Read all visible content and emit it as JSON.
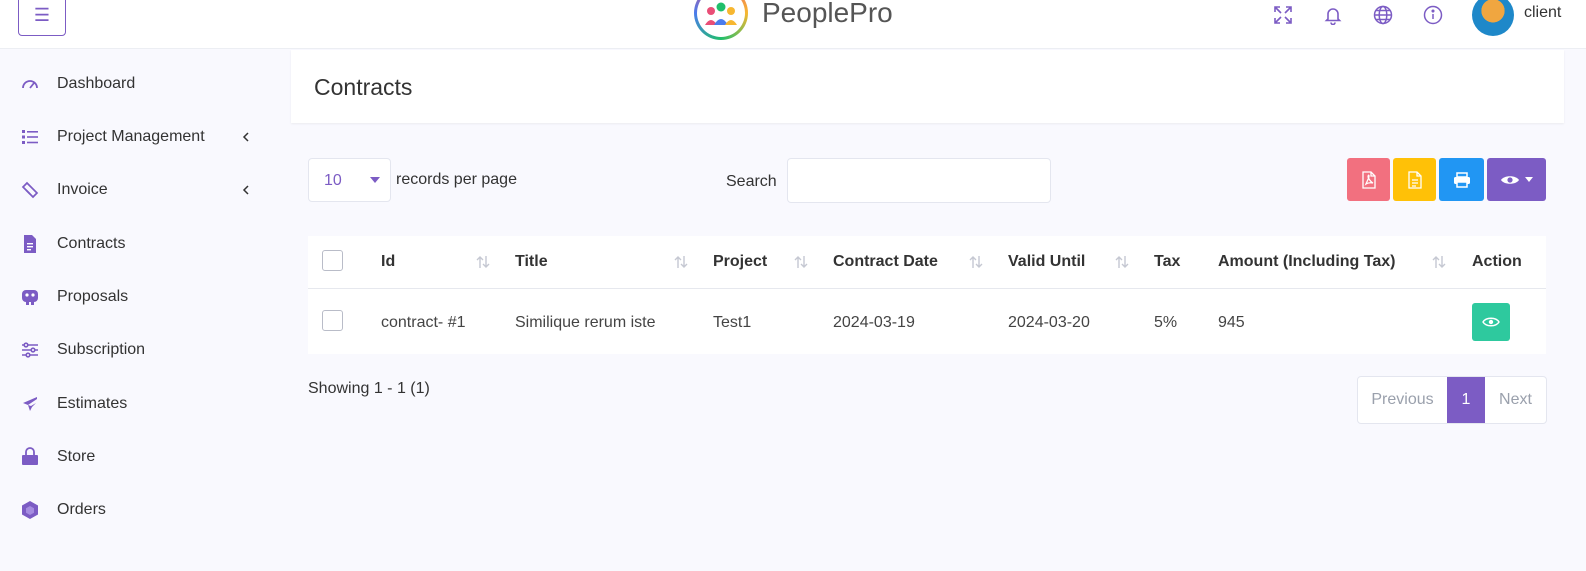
{
  "app": {
    "brand_name": "PeoplePro",
    "user_name": "client"
  },
  "topbar": {
    "icons": [
      "menu-icon",
      "fullscreen-icon",
      "bell-icon",
      "globe-icon",
      "info-icon"
    ]
  },
  "sidebar": {
    "items": [
      {
        "label": "Dashboard",
        "icon": "gauge-icon",
        "has_children": false
      },
      {
        "label": "Project Management",
        "icon": "list-icon",
        "has_children": true
      },
      {
        "label": "Invoice",
        "icon": "ticket-icon",
        "has_children": true
      },
      {
        "label": "Contracts",
        "icon": "document-icon",
        "has_children": false
      },
      {
        "label": "Proposals",
        "icon": "proposal-icon",
        "has_children": false
      },
      {
        "label": "Subscription",
        "icon": "sliders-icon",
        "has_children": false
      },
      {
        "label": "Estimates",
        "icon": "plane-icon",
        "has_children": false
      },
      {
        "label": "Store",
        "icon": "shopping-bag-icon",
        "has_children": false
      },
      {
        "label": "Orders",
        "icon": "hexagon-icon",
        "has_children": false
      }
    ]
  },
  "page": {
    "title": "Contracts"
  },
  "controls": {
    "per_page_value": "10",
    "per_page_label": "records per page",
    "search_label": "Search",
    "search_value": "",
    "buttons": [
      {
        "name": "export-pdf",
        "icon": "pdf-file-icon",
        "color": "#f2707f"
      },
      {
        "name": "export-csv",
        "icon": "file-text-icon",
        "color": "#ffc107"
      },
      {
        "name": "print",
        "icon": "printer-icon",
        "color": "#2196f3"
      },
      {
        "name": "column-visibility",
        "icon": "eye-icon",
        "color": "#7c5cc4"
      }
    ]
  },
  "table": {
    "columns": [
      "Id",
      "Title",
      "Project",
      "Contract Date",
      "Valid Until",
      "Tax",
      "Amount (Including Tax)",
      "Action"
    ],
    "rows": [
      {
        "id": "contract- #1",
        "title": "Similique rerum iste",
        "project": "Test1",
        "contract_date": "2024-03-19",
        "valid_until": "2024-03-20",
        "tax": "5%",
        "amount": "945"
      }
    ]
  },
  "footer": {
    "showing": "Showing 1 - 1 (1)",
    "pagination": {
      "previous": "Previous",
      "current": "1",
      "next": "Next"
    }
  },
  "colors": {
    "accent": "#7c5cc4",
    "success": "#2ec99e"
  }
}
